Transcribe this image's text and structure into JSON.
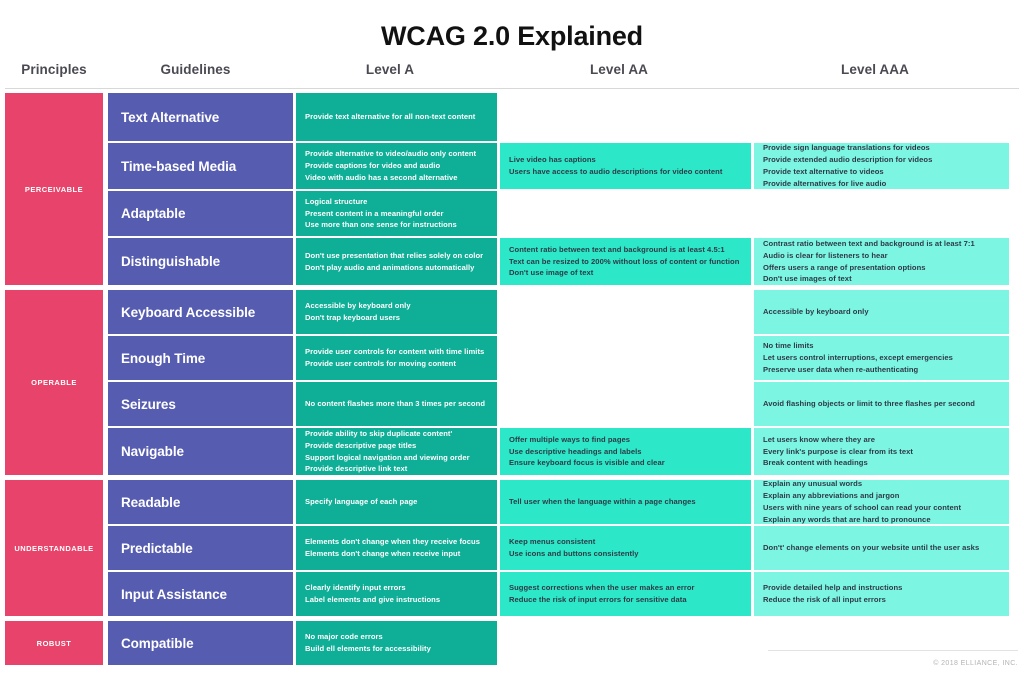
{
  "title": "WCAG 2.0 Explained",
  "colors": {
    "principle": "#e8436a",
    "guideline": "#565cb0",
    "level_a": "#0fae97",
    "level_aa": "#2ce8c8",
    "level_aaa": "#7df5e3",
    "header_text": "#4a4a52"
  },
  "columns": {
    "principles": "Principles",
    "guidelines": "Guidelines",
    "level_a": "Level A",
    "level_aa": "Level AA",
    "level_aaa": "Level AAA"
  },
  "footer": "© 2018 ELLIANCE, INC.",
  "principles": [
    {
      "name": "PERCEIVABLE",
      "guidelines": [
        {
          "name": "Text Alternative",
          "level_a": [
            "Provide text alternative for all non-text content"
          ],
          "level_aa": [],
          "level_aaa": []
        },
        {
          "name": "Time-based Media",
          "level_a": [
            "Provide alternative to video/audio only content",
            "Provide captions for video and audio",
            "Video with audio has a second alternative"
          ],
          "level_aa": [
            "Live video has captions",
            "Users have access to audio descriptions for video content"
          ],
          "level_aaa": [
            "Provide sign language translations for videos",
            "Provide extended audio description for videos",
            "Provide text alternative to videos",
            "Provide alternatives for live audio"
          ]
        },
        {
          "name": "Adaptable",
          "level_a": [
            "Logical structure",
            "Present content in a meaningful order",
            "Use more than one sense for instructions"
          ],
          "level_aa": [],
          "level_aaa": []
        },
        {
          "name": "Distinguishable",
          "level_a": [
            "Don't use presentation that relies solely on color",
            "Don't play audio and animations automatically"
          ],
          "level_aa": [
            "Content ratio between text and background is at least 4.5:1",
            "Text can be resized to 200% without loss of content or function",
            "Don't use image of text"
          ],
          "level_aaa": [
            "Contrast ratio between text and background is at least 7:1",
            "Audio is clear for listeners to hear",
            "Offers users a range of presentation options",
            "Don't use images of text"
          ]
        }
      ]
    },
    {
      "name": "OPERABLE",
      "guidelines": [
        {
          "name": "Keyboard Accessible",
          "level_a": [
            "Accessible by keyboard only",
            "Don't trap keyboard users"
          ],
          "level_aa": [],
          "level_aaa": [
            "Accessible by keyboard only"
          ]
        },
        {
          "name": "Enough Time",
          "level_a": [
            "Provide user controls for content with time limits",
            "Provide user controls for moving content"
          ],
          "level_aa": [],
          "level_aaa": [
            "No time limits",
            "Let users control interruptions, except emergencies",
            "Preserve user data when re-authenticating"
          ]
        },
        {
          "name": "Seizures",
          "level_a": [
            "No content flashes more than 3 times per second"
          ],
          "level_aa": [],
          "level_aaa": [
            "Avoid flashing objects or limit to three flashes per second"
          ]
        },
        {
          "name": "Navigable",
          "level_a": [
            "Provide ability to skip duplicate content'",
            "Provide descriptive page titles",
            "Support logical navigation and viewing order",
            "Provide descriptive link text"
          ],
          "level_aa": [
            "Offer multiple ways to find pages",
            "Use descriptive headings and labels",
            "Ensure keyboard focus is visible and clear"
          ],
          "level_aaa": [
            "Let users know where they are",
            "Every link's purpose is clear from its text",
            "Break content with headings"
          ]
        }
      ]
    },
    {
      "name": "UNDERSTANDABLE",
      "guidelines": [
        {
          "name": "Readable",
          "level_a": [
            "Specify language of each page"
          ],
          "level_aa": [
            "Tell user when the language within a page changes"
          ],
          "level_aaa": [
            "Explain any unusual words",
            "Explain any abbreviations and jargon",
            "Users with nine years of school can read your content",
            "Explain any words that are hard to pronounce"
          ]
        },
        {
          "name": "Predictable",
          "level_a": [
            "Elements don't change when they receive focus",
            "Elements don't change when receive input"
          ],
          "level_aa": [
            "Keep menus consistent",
            "Use icons and buttons consistently"
          ],
          "level_aaa": [
            "Don't' change elements on your website until the user asks"
          ]
        },
        {
          "name": "Input Assistance",
          "level_a": [
            "Clearly identify input errors",
            "Label elements and give instructions"
          ],
          "level_aa": [
            "Suggest corrections when the user makes an error",
            "Reduce the risk of input errors for sensitive data"
          ],
          "level_aaa": [
            "Provide detailed help and instructions",
            "Reduce the risk of all input errors"
          ]
        }
      ]
    },
    {
      "name": "ROBUST",
      "guidelines": [
        {
          "name": "Compatible",
          "level_a": [
            "No major code errors",
            "Build ell elements for accessibility"
          ],
          "level_aa": [],
          "level_aaa": []
        }
      ]
    }
  ]
}
